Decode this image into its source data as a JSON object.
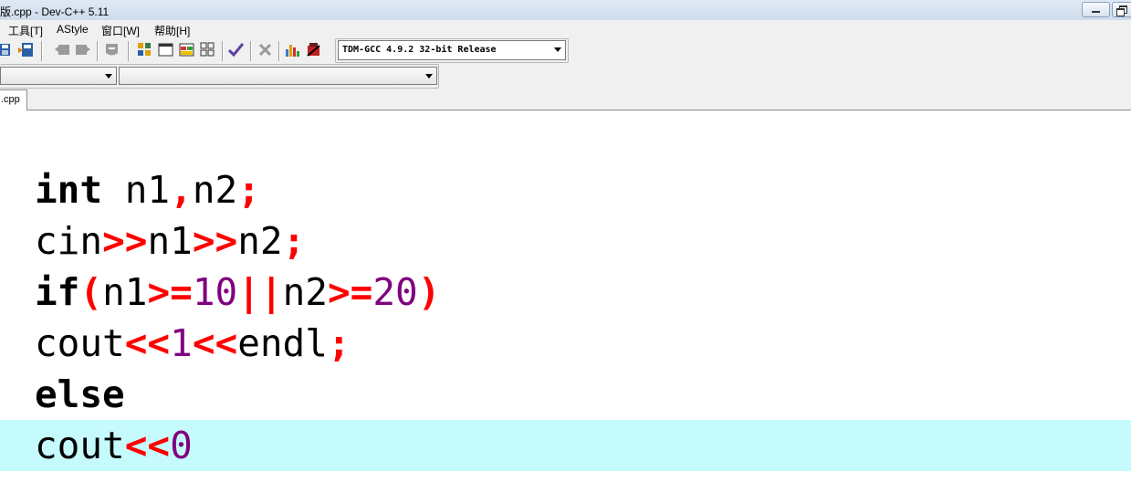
{
  "window": {
    "title": "版.cpp - Dev-C++ 5.11"
  },
  "menu": {
    "items": [
      "工具[T]",
      "AStyle",
      "窗口[W]",
      "帮助[H]"
    ]
  },
  "toolbar": {
    "compiler": "TDM-GCC 4.9.2 32-bit Release",
    "class_combo": "",
    "method_combo": ""
  },
  "tab": {
    "label": ".cpp"
  },
  "colors": {
    "keyword": "#000000",
    "symbol": "#ff0000",
    "number": "#800080",
    "current_line": "#c6fbfd"
  },
  "code": {
    "lines": [
      [
        {
          "t": "int",
          "c": "kw"
        },
        {
          "t": " n1",
          "c": ""
        },
        {
          "t": ",",
          "c": "sym"
        },
        {
          "t": "n2",
          "c": ""
        },
        {
          "t": ";",
          "c": "sym"
        }
      ],
      [
        {
          "t": "cin",
          "c": ""
        },
        {
          "t": ">>",
          "c": "sym"
        },
        {
          "t": "n1",
          "c": ""
        },
        {
          "t": ">>",
          "c": "sym"
        },
        {
          "t": "n2",
          "c": ""
        },
        {
          "t": ";",
          "c": "sym"
        }
      ],
      [
        {
          "t": "if",
          "c": "kw"
        },
        {
          "t": "(",
          "c": "sym"
        },
        {
          "t": "n1",
          "c": ""
        },
        {
          "t": ">=",
          "c": "sym"
        },
        {
          "t": "10",
          "c": "num"
        },
        {
          "t": "||",
          "c": "sym"
        },
        {
          "t": "n2",
          "c": ""
        },
        {
          "t": ">=",
          "c": "sym"
        },
        {
          "t": "20",
          "c": "num"
        },
        {
          "t": ")",
          "c": "sym"
        }
      ],
      [
        {
          "t": "cout",
          "c": ""
        },
        {
          "t": "<<",
          "c": "sym"
        },
        {
          "t": "1",
          "c": "num"
        },
        {
          "t": "<<",
          "c": "sym"
        },
        {
          "t": "endl",
          "c": ""
        },
        {
          "t": ";",
          "c": "sym"
        }
      ],
      [
        {
          "t": "else",
          "c": "kw"
        }
      ],
      [
        {
          "t": "cout",
          "c": ""
        },
        {
          "t": "<<",
          "c": "sym"
        },
        {
          "t": "0",
          "c": "num"
        }
      ]
    ],
    "current_line_index": 5
  }
}
